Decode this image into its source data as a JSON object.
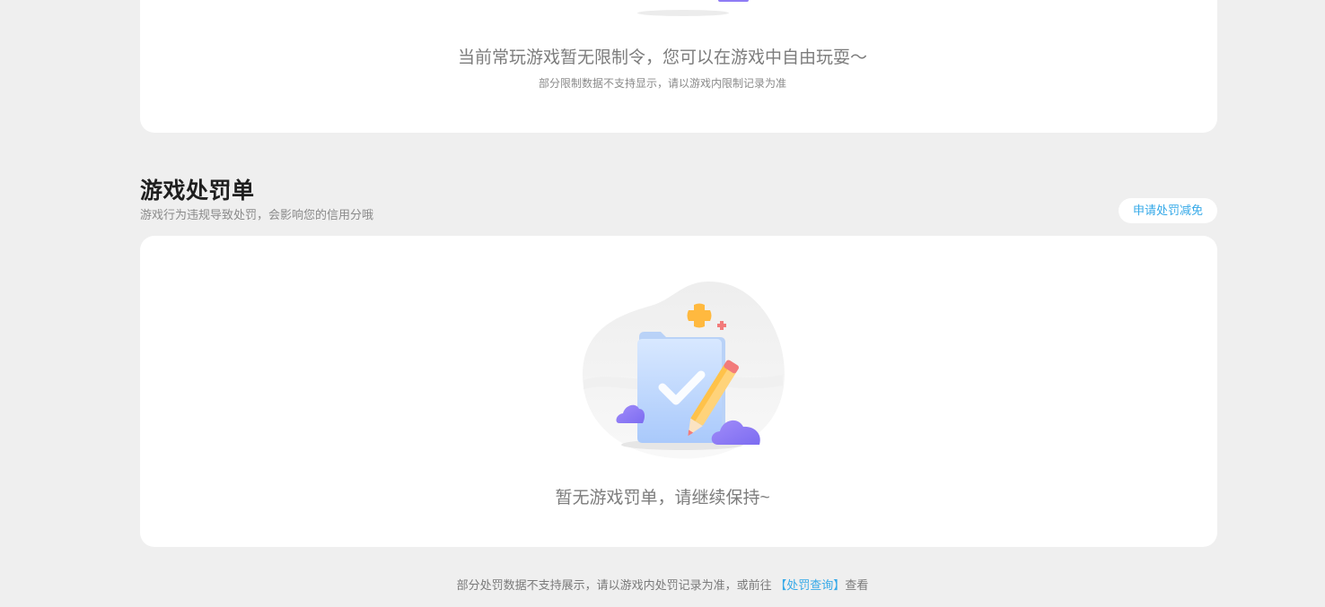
{
  "restrictions": {
    "empty_text": "当前常玩游戏暂无限制令，您可以在游戏中自由玩耍～",
    "note": "部分限制数据不支持显示，请以游戏内限制记录为准"
  },
  "penalty_section": {
    "title": "游戏处罚单",
    "subtitle": "游戏行为违规导致处罚，会影响您的信用分哦",
    "appeal_button": "申请处罚减免",
    "empty_text": "暂无游戏罚单，请继续保持~",
    "illustration_icon": "folder-check-pencil-icon"
  },
  "footer": {
    "prefix": "部分处罚数据不支持展示，请以游戏内处罚记录为准，或前往",
    "link": "【处罚查询】",
    "suffix": "查看"
  },
  "colors": {
    "background": "#efefef",
    "card": "#ffffff",
    "accent": "#35a9e8",
    "title": "#1f1f1f"
  }
}
